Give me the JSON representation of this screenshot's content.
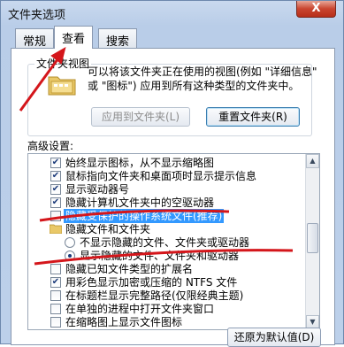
{
  "window": {
    "title": "文件夹选项",
    "close_label": "X"
  },
  "tabs": [
    {
      "label": "常规",
      "active": false
    },
    {
      "label": "查看",
      "active": true
    },
    {
      "label": "搜索",
      "active": false
    }
  ],
  "folder_views": {
    "group_title": "文件夹视图",
    "description": "可以将该文件夹正在使用的视图(例如 \"详细信息\" 或 \"图标\") 应用到所有这种类型的文件夹中。",
    "apply_button": "应用到文件夹(L)",
    "reset_button": "重置文件夹(R)"
  },
  "advanced": {
    "label": "高级设置:",
    "rows": [
      {
        "kind": "checkbox",
        "checked": true,
        "indent": 1,
        "label": "始终显示图标，从不显示缩略图"
      },
      {
        "kind": "checkbox",
        "checked": true,
        "indent": 1,
        "label": "鼠标指向文件夹和桌面项时显示提示信息"
      },
      {
        "kind": "checkbox",
        "checked": true,
        "indent": 1,
        "label": "显示驱动器号"
      },
      {
        "kind": "checkbox",
        "checked": true,
        "indent": 1,
        "label": "隐藏计算机文件夹中的空驱动器"
      },
      {
        "kind": "checkbox",
        "checked": false,
        "indent": 1,
        "selected": true,
        "label": "隐藏受保护的操作系统文件(推荐)"
      },
      {
        "kind": "folder",
        "indent": 1,
        "label": "隐藏文件和文件夹"
      },
      {
        "kind": "radio",
        "checked": false,
        "indent": 2,
        "label": "不显示隐藏的文件、文件夹或驱动器"
      },
      {
        "kind": "radio",
        "checked": true,
        "indent": 2,
        "label": "显示隐藏的文件、文件夹和驱动器"
      },
      {
        "kind": "checkbox",
        "checked": false,
        "indent": 1,
        "label": "隐藏已知文件类型的扩展名"
      },
      {
        "kind": "checkbox",
        "checked": true,
        "indent": 1,
        "label": "用彩色显示加密或压缩的 NTFS 文件"
      },
      {
        "kind": "checkbox",
        "checked": false,
        "indent": 1,
        "label": "在标题栏显示完整路径(仅限经典主题)"
      },
      {
        "kind": "checkbox",
        "checked": false,
        "indent": 1,
        "label": "在单独的进程中打开文件夹窗口"
      },
      {
        "kind": "checkbox",
        "checked": false,
        "indent": 1,
        "label": "在缩略图上显示文件图标"
      }
    ]
  },
  "restore_button": "还原为默认值(D)",
  "annotation_color": "#d4161b"
}
